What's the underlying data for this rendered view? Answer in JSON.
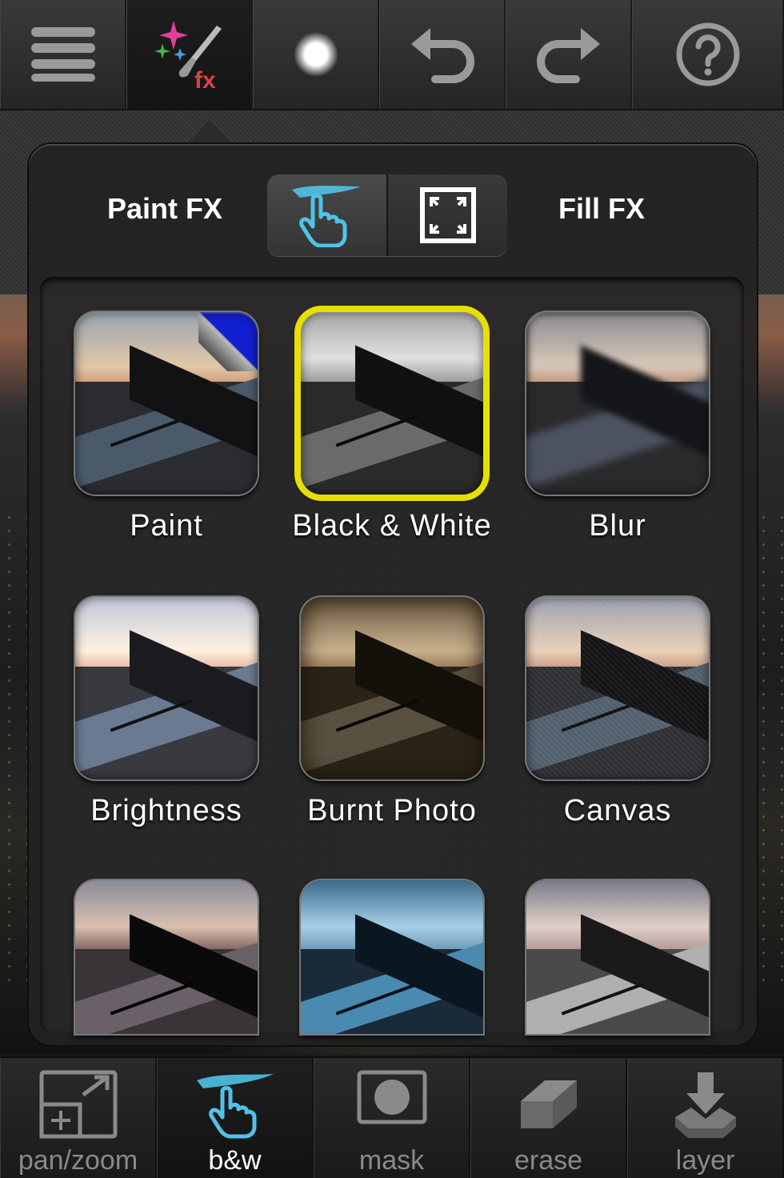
{
  "toolbar": {
    "items": [
      {
        "name": "menu-icon"
      },
      {
        "name": "fx-brush-icon",
        "fx_label": "fx",
        "active": true
      },
      {
        "name": "brush-size-icon"
      },
      {
        "name": "undo-icon"
      },
      {
        "name": "redo-icon"
      },
      {
        "name": "help-icon"
      }
    ]
  },
  "popover": {
    "left_label": "Paint FX",
    "right_label": "Fill FX",
    "segment": {
      "selected": "paint",
      "options": [
        "hand-brush-icon",
        "fullscreen-fill-icon"
      ]
    }
  },
  "effects": [
    {
      "label": "Paint",
      "style": "paint",
      "new": true
    },
    {
      "label": "Black & White",
      "style": "bw",
      "selected": true
    },
    {
      "label": "Blur",
      "style": "blur"
    },
    {
      "label": "Brightness",
      "style": "bright"
    },
    {
      "label": "Burnt Photo",
      "style": "burnt"
    },
    {
      "label": "Canvas",
      "style": "canvas"
    },
    {
      "label": "",
      "style": "posterize"
    },
    {
      "label": "",
      "style": "cool"
    },
    {
      "label": "",
      "style": "sketch"
    }
  ],
  "bottom": {
    "pan_zoom": "pan/zoom",
    "bw": "b&w",
    "mask": "mask",
    "erase": "erase",
    "layer": "layer"
  },
  "colors": {
    "selection": "#e8df00",
    "accent_blue": "#4fc3e8"
  }
}
